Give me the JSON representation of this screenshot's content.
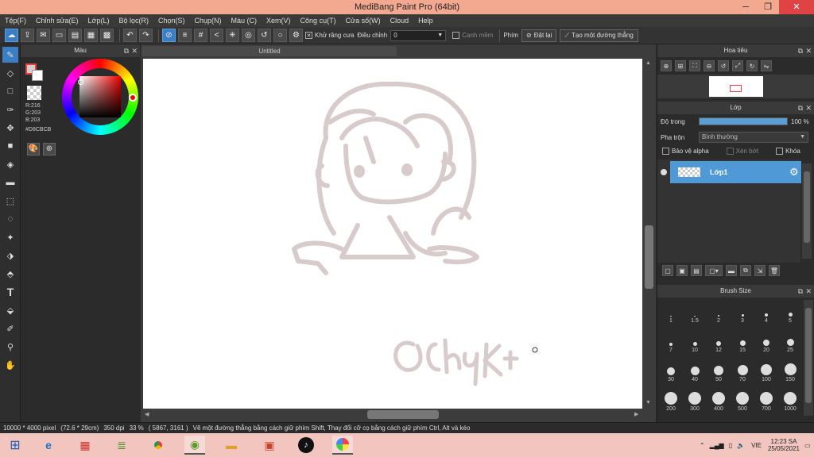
{
  "window": {
    "title": "MediBang Paint Pro (64bit)",
    "min": "─",
    "max": "❐",
    "close": "✕"
  },
  "menu": [
    "Tệp(F)",
    "Chỉnh sửa(E)",
    "Lớp(L)",
    "Bộ lọc(R)",
    "Chọn(S)",
    "Chụp(N)",
    "Màu (C)",
    "Xem(V)",
    "Công cụ(T)",
    "Cửa số(W)",
    "Cloud",
    "Help"
  ],
  "toolbar": {
    "antialias_label": "Khử răng cưa",
    "correction_label": "Điều chỉnh",
    "correction_value": "0",
    "canh_mem_label": "Canh mềm",
    "phim_label": "Phím",
    "reset_label": "Đặt lại",
    "straight_line_label": "Tạo một đường thẳng"
  },
  "color_panel": {
    "title": "Màu",
    "r": "R:216",
    "g": "G:203",
    "b": "B:203",
    "hex": "#D8CBCB",
    "fg_color": "#d8cbcb",
    "accent": "#e04343"
  },
  "document": {
    "tab_title": "Untitled"
  },
  "navigator": {
    "title": "Hoa tiêu"
  },
  "layer_panel": {
    "title": "Lớp",
    "opacity_label": "Độ trong",
    "opacity_value": "100 %",
    "opacity_fraction": 1.0,
    "blend_label": "Pha trộn",
    "blend_value": "Bình thường",
    "protect_alpha_label": "Bảo vệ alpha",
    "clip_label": "Xén bớt",
    "lock_label": "Khóa",
    "layer_name": "Lớp1"
  },
  "brush_size": {
    "title": "Brush Size",
    "sizes": [
      "1",
      "1.5",
      "2",
      "3",
      "4",
      "5",
      "7",
      "10",
      "12",
      "15",
      "20",
      "25",
      "30",
      "40",
      "50",
      "70",
      "100",
      "150",
      "200",
      "300",
      "400",
      "500",
      "700",
      "1000"
    ]
  },
  "status": {
    "dimensions": "10000 * 4000 pixel",
    "physical": "(72.6 * 29cm)",
    "dpi": "350 dpi",
    "zoom": "33 %",
    "coords": "( 5867, 3161 )",
    "hint": "Vẽ một đường thẳng bằng cách giữ phím Shift, Thay đổi cỡ cọ bằng cách giữ phím Ctrl, Alt và kéo"
  },
  "taskbar": {
    "lang": "VIE",
    "time": "12:23 SA",
    "date": "25/05/2021"
  }
}
